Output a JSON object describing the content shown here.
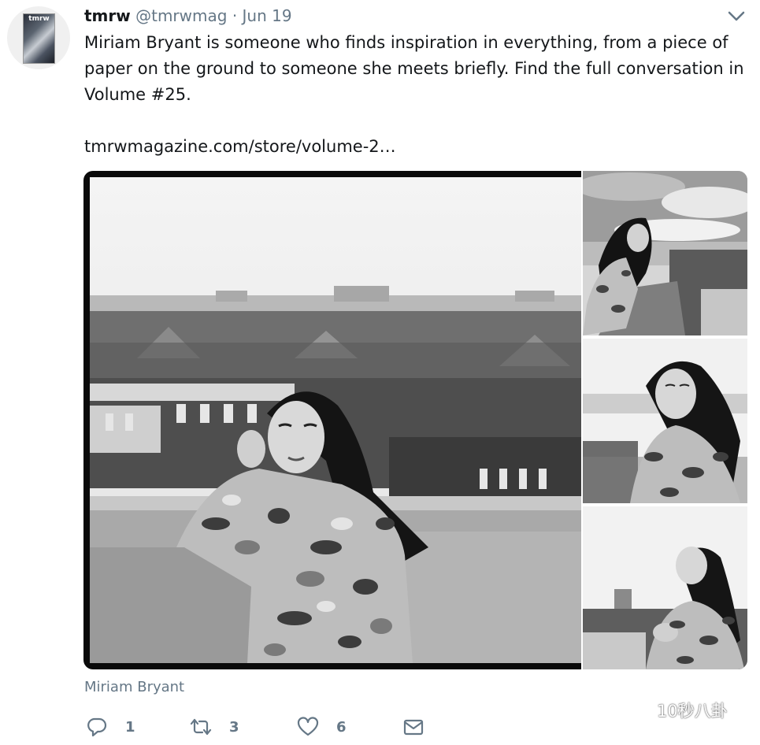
{
  "tweet": {
    "author_name": "tmrw",
    "author_handle": "@tmrwmag",
    "separator": "·",
    "date": "Jun 19",
    "text": "Miriam Bryant is someone who finds inspiration in everything, from a piece of paper on the ground to someone she meets briefly. Find the full conversation in Volume #25.",
    "link": "tmrwmagazine.com/store/volume-2…",
    "avatar_text": "tmrw",
    "media_caption": "Miriam Bryant",
    "media_count": 4
  },
  "actions": {
    "reply": {
      "icon": "reply-icon",
      "count": "1"
    },
    "retweet": {
      "icon": "retweet-icon",
      "count": "3"
    },
    "like": {
      "icon": "heart-icon",
      "count": "6"
    },
    "dm": {
      "icon": "envelope-icon"
    }
  },
  "watermark": {
    "text": "10秒八卦"
  },
  "colors": {
    "text": "#14171a",
    "secondary": "#657786",
    "background": "#ffffff"
  }
}
